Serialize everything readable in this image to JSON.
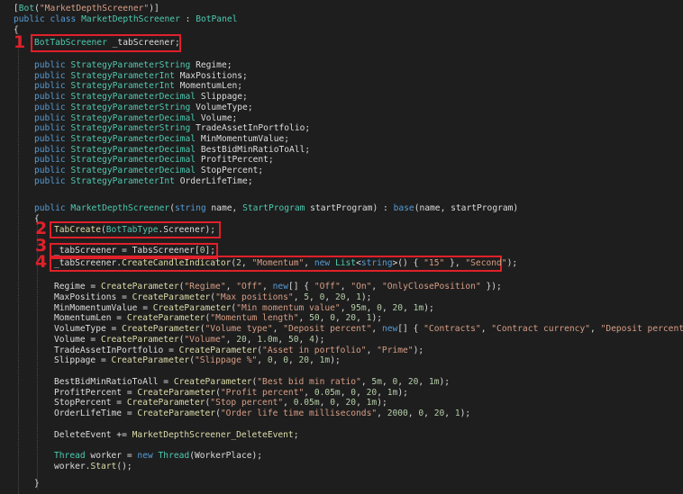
{
  "markers": [
    "1",
    "2",
    "3",
    "4"
  ],
  "code": {
    "l1_attr_open": "[",
    "l1_attr_name": "Bot",
    "l1_attr_arg": "\"MarketDepthScreener\"",
    "l1_attr_close": ")]",
    "l1_paren": "(",
    "l2_public": "public",
    "l2_class": "class",
    "l2_name": "MarketDepthScreener",
    "l2_colon": " : ",
    "l2_base": "BotPanel",
    "brace_open": "{",
    "l4_type": "BotTabScreener",
    "l4_field": " _tabScreener;",
    "params": [
      {
        "mod": "public",
        "type": "StrategyParameterString",
        "name": " Regime;"
      },
      {
        "mod": "public",
        "type": "StrategyParameterInt",
        "name": " MaxPositions;"
      },
      {
        "mod": "public",
        "type": "StrategyParameterInt",
        "name": " MomentumLen;"
      },
      {
        "mod": "public",
        "type": "StrategyParameterDecimal",
        "name": " Slippage;"
      },
      {
        "mod": "public",
        "type": "StrategyParameterString",
        "name": " VolumeType;"
      },
      {
        "mod": "public",
        "type": "StrategyParameterDecimal",
        "name": " Volume;"
      },
      {
        "mod": "public",
        "type": "StrategyParameterString",
        "name": " TradeAssetInPortfolio;"
      },
      {
        "mod": "public",
        "type": "StrategyParameterDecimal",
        "name": " MinMomentumValue;"
      },
      {
        "mod": "public",
        "type": "StrategyParameterDecimal",
        "name": " BestBidMinRatioToAll;"
      },
      {
        "mod": "public",
        "type": "StrategyParameterDecimal",
        "name": " ProfitPercent;"
      },
      {
        "mod": "public",
        "type": "StrategyParameterDecimal",
        "name": " StopPercent;"
      },
      {
        "mod": "public",
        "type": "StrategyParameterInt",
        "name": " OrderLifeTime;"
      }
    ],
    "ctor_public": "public",
    "ctor_name": " MarketDepthScreener",
    "ctor_p1": "(",
    "ctor_string": "string",
    "ctor_p2": " name, ",
    "ctor_sp": "StartProgram",
    "ctor_p3": " startProgram) : ",
    "ctor_base": "base",
    "ctor_p4": "(name, startProgram)",
    "tab_create": "TabCreate",
    "tab_create_a": "(",
    "tab_create_type": "BotTabType",
    "tab_create_b": ".Screener);",
    "assign3_a": "_tabScreener = TabsScreener[",
    "assign3_n": "0",
    "assign3_b": "];",
    "l4_a": "_tabScreener.",
    "l4_method": "CreateCandleIndicator",
    "l4_b": "(",
    "l4_n2": "2",
    "l4_c": ", ",
    "l4_mom": "\"Momentum\"",
    "l4_d": ", ",
    "l4_new": "new",
    "l4_e": " ",
    "l4_list": "List",
    "l4_lt": "<",
    "l4_str": "string",
    "l4_gt": ">() { ",
    "l4_15": "\"15\"",
    "l4_f": " }, ",
    "l4_second": "\"Second\"",
    "l4_g": ");",
    "create_lines": [
      [
        [
          "id",
          "Regime = "
        ],
        [
          "m",
          "CreateParameter"
        ],
        [
          "id",
          "("
        ],
        [
          "s",
          "\"Regime\""
        ],
        [
          "id",
          ", "
        ],
        [
          "s",
          "\"Off\""
        ],
        [
          "id",
          ", "
        ],
        [
          "k",
          "new"
        ],
        [
          "id",
          "[] { "
        ],
        [
          "s",
          "\"Off\""
        ],
        [
          "id",
          ", "
        ],
        [
          "s",
          "\"On\""
        ],
        [
          "id",
          ", "
        ],
        [
          "s",
          "\"OnlyClosePosition\""
        ],
        [
          "id",
          " });"
        ]
      ],
      [
        [
          "id",
          "MaxPositions = "
        ],
        [
          "m",
          "CreateParameter"
        ],
        [
          "id",
          "("
        ],
        [
          "s",
          "\"Max positions\""
        ],
        [
          "id",
          ", "
        ],
        [
          "n",
          "5"
        ],
        [
          "id",
          ", "
        ],
        [
          "n",
          "0"
        ],
        [
          "id",
          ", "
        ],
        [
          "n",
          "20"
        ],
        [
          "id",
          ", "
        ],
        [
          "n",
          "1"
        ],
        [
          "id",
          ");"
        ]
      ],
      [
        [
          "id",
          "MinMomentumValue = "
        ],
        [
          "m",
          "CreateParameter"
        ],
        [
          "id",
          "("
        ],
        [
          "s",
          "\"Min momentum value\""
        ],
        [
          "id",
          ", "
        ],
        [
          "n",
          "95m"
        ],
        [
          "id",
          ", "
        ],
        [
          "n",
          "0"
        ],
        [
          "id",
          ", "
        ],
        [
          "n",
          "20"
        ],
        [
          "id",
          ", "
        ],
        [
          "n",
          "1m"
        ],
        [
          "id",
          ");"
        ]
      ],
      [
        [
          "id",
          "MomentumLen = "
        ],
        [
          "m",
          "CreateParameter"
        ],
        [
          "id",
          "("
        ],
        [
          "s",
          "\"Momentum length\""
        ],
        [
          "id",
          ", "
        ],
        [
          "n",
          "50"
        ],
        [
          "id",
          ", "
        ],
        [
          "n",
          "0"
        ],
        [
          "id",
          ", "
        ],
        [
          "n",
          "20"
        ],
        [
          "id",
          ", "
        ],
        [
          "n",
          "1"
        ],
        [
          "id",
          ");"
        ]
      ],
      [
        [
          "id",
          "VolumeType = "
        ],
        [
          "m",
          "CreateParameter"
        ],
        [
          "id",
          "("
        ],
        [
          "s",
          "\"Volume type\""
        ],
        [
          "id",
          ", "
        ],
        [
          "s",
          "\"Deposit percent\""
        ],
        [
          "id",
          ", "
        ],
        [
          "k",
          "new"
        ],
        [
          "id",
          "[] { "
        ],
        [
          "s",
          "\"Contracts\""
        ],
        [
          "id",
          ", "
        ],
        [
          "s",
          "\"Contract currency\""
        ],
        [
          "id",
          ", "
        ],
        [
          "s",
          "\"Deposit percent\""
        ],
        [
          "id",
          " });"
        ]
      ],
      [
        [
          "id",
          "Volume = "
        ],
        [
          "m",
          "CreateParameter"
        ],
        [
          "id",
          "("
        ],
        [
          "s",
          "\"Volume\""
        ],
        [
          "id",
          ", "
        ],
        [
          "n",
          "20"
        ],
        [
          "id",
          ", "
        ],
        [
          "n",
          "1.0m"
        ],
        [
          "id",
          ", "
        ],
        [
          "n",
          "50"
        ],
        [
          "id",
          ", "
        ],
        [
          "n",
          "4"
        ],
        [
          "id",
          ");"
        ]
      ],
      [
        [
          "id",
          "TradeAssetInPortfolio = "
        ],
        [
          "m",
          "CreateParameter"
        ],
        [
          "id",
          "("
        ],
        [
          "s",
          "\"Asset in portfolio\""
        ],
        [
          "id",
          ", "
        ],
        [
          "s",
          "\"Prime\""
        ],
        [
          "id",
          ");"
        ]
      ],
      [
        [
          "id",
          "Slippage = "
        ],
        [
          "m",
          "CreateParameter"
        ],
        [
          "id",
          "("
        ],
        [
          "s",
          "\"Slippage %\""
        ],
        [
          "id",
          ", "
        ],
        [
          "n",
          "0"
        ],
        [
          "id",
          ", "
        ],
        [
          "n",
          "0"
        ],
        [
          "id",
          ", "
        ],
        [
          "n",
          "20"
        ],
        [
          "id",
          ", "
        ],
        [
          "n",
          "1m"
        ],
        [
          "id",
          ");"
        ]
      ],
      [],
      [
        [
          "id",
          "BestBidMinRatioToAll = "
        ],
        [
          "m",
          "CreateParameter"
        ],
        [
          "id",
          "("
        ],
        [
          "s",
          "\"Best bid min ratio\""
        ],
        [
          "id",
          ", "
        ],
        [
          "n",
          "5m"
        ],
        [
          "id",
          ", "
        ],
        [
          "n",
          "0"
        ],
        [
          "id",
          ", "
        ],
        [
          "n",
          "20"
        ],
        [
          "id",
          ", "
        ],
        [
          "n",
          "1m"
        ],
        [
          "id",
          ");"
        ]
      ],
      [
        [
          "id",
          "ProfitPercent = "
        ],
        [
          "m",
          "CreateParameter"
        ],
        [
          "id",
          "("
        ],
        [
          "s",
          "\"Profit percent\""
        ],
        [
          "id",
          ", "
        ],
        [
          "n",
          "0.05m"
        ],
        [
          "id",
          ", "
        ],
        [
          "n",
          "0"
        ],
        [
          "id",
          ", "
        ],
        [
          "n",
          "20"
        ],
        [
          "id",
          ", "
        ],
        [
          "n",
          "1m"
        ],
        [
          "id",
          ");"
        ]
      ],
      [
        [
          "id",
          "StopPercent = "
        ],
        [
          "m",
          "CreateParameter"
        ],
        [
          "id",
          "("
        ],
        [
          "s",
          "\"Stop percent\""
        ],
        [
          "id",
          ", "
        ],
        [
          "n",
          "0.05m"
        ],
        [
          "id",
          ", "
        ],
        [
          "n",
          "0"
        ],
        [
          "id",
          ", "
        ],
        [
          "n",
          "20"
        ],
        [
          "id",
          ", "
        ],
        [
          "n",
          "1m"
        ],
        [
          "id",
          ");"
        ]
      ],
      [
        [
          "id",
          "OrderLifeTime = "
        ],
        [
          "m",
          "CreateParameter"
        ],
        [
          "id",
          "("
        ],
        [
          "s",
          "\"Order life time milliseconds\""
        ],
        [
          "id",
          ", "
        ],
        [
          "n",
          "2000"
        ],
        [
          "id",
          ", "
        ],
        [
          "n",
          "0"
        ],
        [
          "id",
          ", "
        ],
        [
          "n",
          "20"
        ],
        [
          "id",
          ", "
        ],
        [
          "n",
          "1"
        ],
        [
          "id",
          ");"
        ]
      ],
      [],
      [
        [
          "id",
          "DeleteEvent += "
        ],
        [
          "m",
          "MarketDepthScreener_DeleteEvent"
        ],
        [
          "id",
          ";"
        ]
      ],
      [],
      [
        [
          "t",
          "Thread"
        ],
        [
          "id",
          " worker = "
        ],
        [
          "k",
          "new"
        ],
        [
          "id",
          " "
        ],
        [
          "t",
          "Thread"
        ],
        [
          "id",
          "(WorkerPlace);"
        ]
      ],
      [
        [
          "id",
          "worker."
        ],
        [
          "m",
          "Start"
        ],
        [
          "id",
          "();"
        ]
      ]
    ],
    "brace_close": "}"
  },
  "colors": {
    "background": "#1e1e1e",
    "keyword": "#569cd6",
    "type": "#4ec9b0",
    "string": "#d69d85",
    "number": "#b5cea8",
    "method": "#dcdcaa",
    "annotation": "#e0202a"
  }
}
